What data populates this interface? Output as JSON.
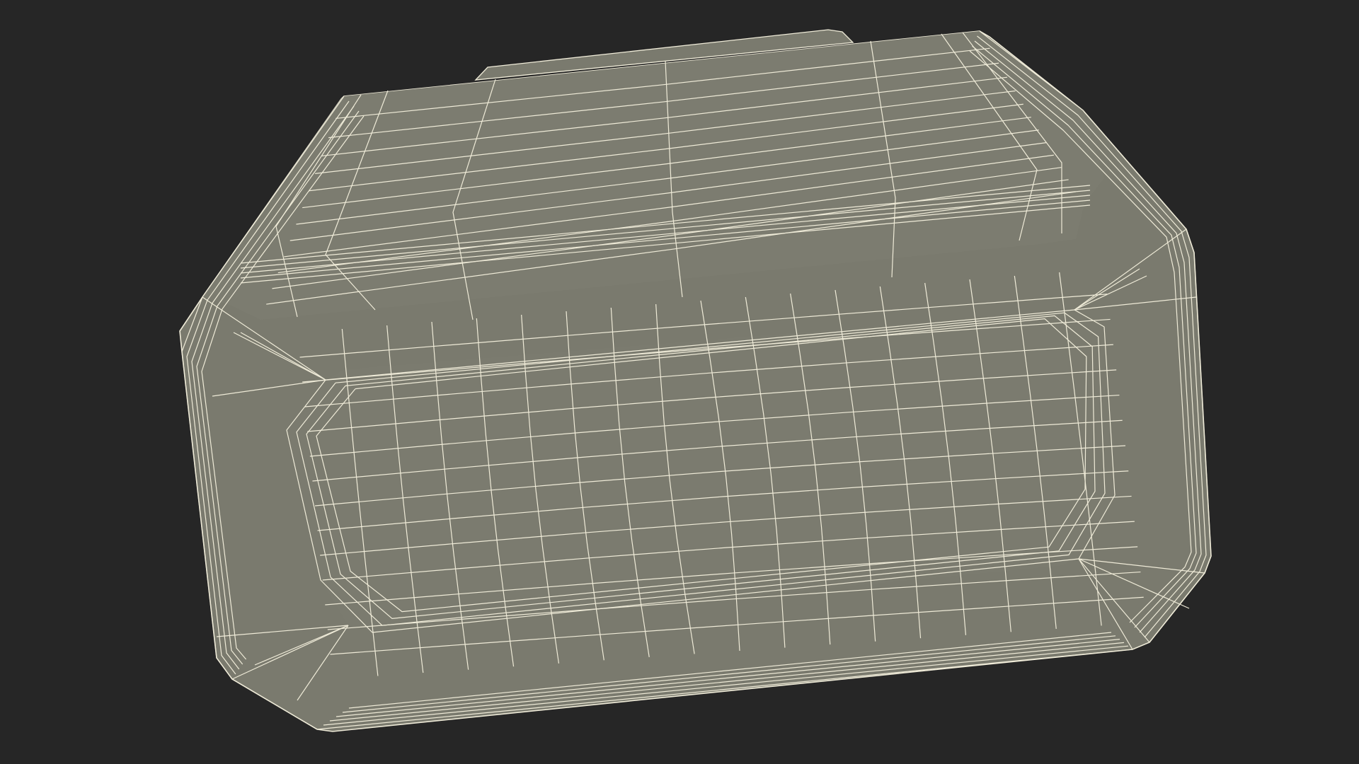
{
  "scene": {
    "background_color": "#262626",
    "surface_color": "#7a7a6e",
    "wire_color": "#efebd8",
    "subject": "wireframe-mesh-render"
  }
}
